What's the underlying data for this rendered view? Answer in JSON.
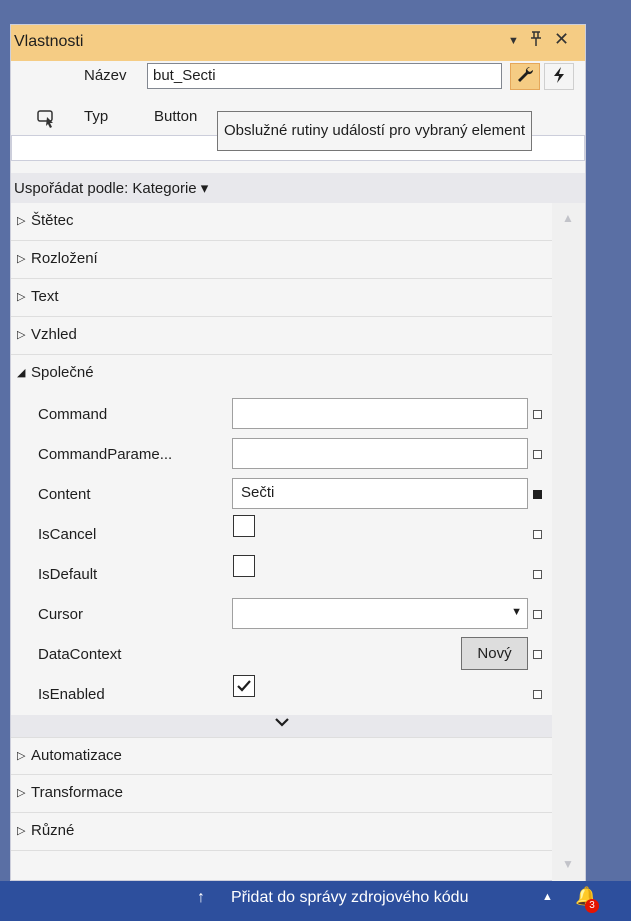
{
  "panel": {
    "title": "Vlastnosti"
  },
  "titlebar_icons": [
    "dropdown-icon",
    "pin-icon",
    "close-icon"
  ],
  "header": {
    "name_label": "Název",
    "name_value": "but_Secti",
    "type_label": "Typ",
    "type_value": "Button",
    "tooltip": "Obslužné rutiny událostí pro vybraný element"
  },
  "sort": {
    "label": "Uspořádat podle: Kategorie"
  },
  "categories_top": [
    {
      "label": "Štětec"
    },
    {
      "label": "Rozložení"
    },
    {
      "label": "Text"
    },
    {
      "label": "Vzhled"
    }
  ],
  "common": {
    "label": "Společné",
    "props": [
      {
        "name": "Command",
        "value": ""
      },
      {
        "name": "CommandParame...",
        "value": ""
      },
      {
        "name": "Content",
        "value": "Sečti"
      },
      {
        "name": "IsCancel",
        "checked": false
      },
      {
        "name": "IsDefault",
        "checked": false
      },
      {
        "name": "Cursor",
        "value": ""
      },
      {
        "name": "DataContext",
        "button": "Nový"
      },
      {
        "name": "IsEnabled",
        "checked": true
      }
    ]
  },
  "categories_bottom": [
    {
      "label": "Automatizace"
    },
    {
      "label": "Transformace"
    },
    {
      "label": "Různé"
    }
  ],
  "statusbar": {
    "text": "Přidat do správy zdrojového kódu",
    "badge": "3"
  },
  "colors": {
    "accent_tab": "#f5cc84",
    "statusbar": "#2d4f9d",
    "background": "#5a6fa4"
  }
}
